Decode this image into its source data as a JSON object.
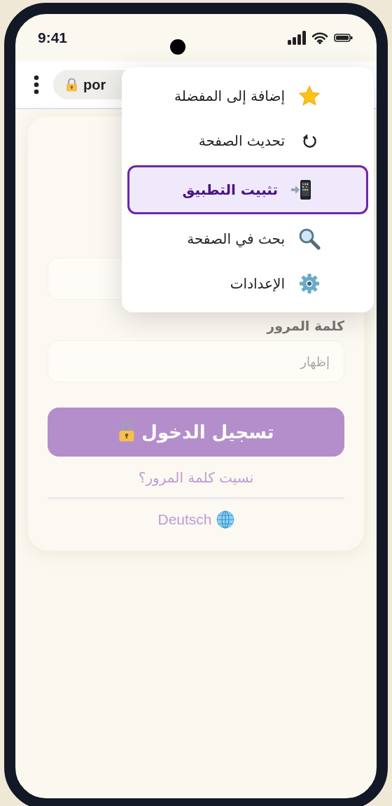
{
  "status_bar": {
    "time": "9:41"
  },
  "browser_bar": {
    "url": "por"
  },
  "menu": {
    "items": [
      {
        "kind": "star",
        "label": "إضافة إلى المفضلة",
        "selected": false
      },
      {
        "kind": "refresh",
        "label": "تحديث الصفحة",
        "selected": false
      },
      {
        "kind": "install",
        "label": "تثبيت التطبيق",
        "selected": true
      },
      {
        "kind": "search",
        "label": "بحث في الصفحة",
        "selected": false
      },
      {
        "kind": "settings",
        "label": "الإعدادات",
        "selected": false
      }
    ]
  },
  "login": {
    "password_label": "كلمة المرور",
    "password_toggle": "إظهار",
    "submit": "تسجيل الدخول",
    "forgot_link": "نسيت كلمة المرور؟",
    "language": "Deutsch"
  }
}
